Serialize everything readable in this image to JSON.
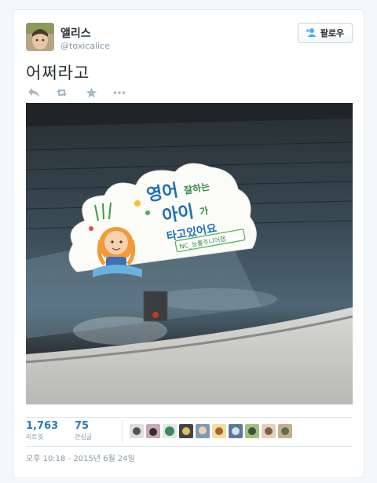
{
  "tweet": {
    "author": {
      "display_name": "앨리스",
      "handle": "@toxicalice"
    },
    "follow_label": "팔로우",
    "text": "어쩌라고",
    "actions": [
      "reply-icon",
      "retweet-icon",
      "favorite-icon",
      "more-icon"
    ],
    "media": {
      "sticker": {
        "line1_big": "영어",
        "line1_small": "잘하는",
        "line2_big": "아이",
        "line2_small": "가",
        "line3": "타고있어요",
        "badge": "NC_능률주니어랩"
      }
    },
    "stats": {
      "retweets_count": "1,763",
      "retweets_label": "리트윗",
      "favorites_count": "75",
      "favorites_label": "관심글"
    },
    "favoriter_count": 10,
    "timestamp": "오후 10:18 - 2015년 6월 24일"
  },
  "colors": {
    "link": "#2b7bb9",
    "muted": "#8899a6",
    "border": "#e1e8ed"
  }
}
